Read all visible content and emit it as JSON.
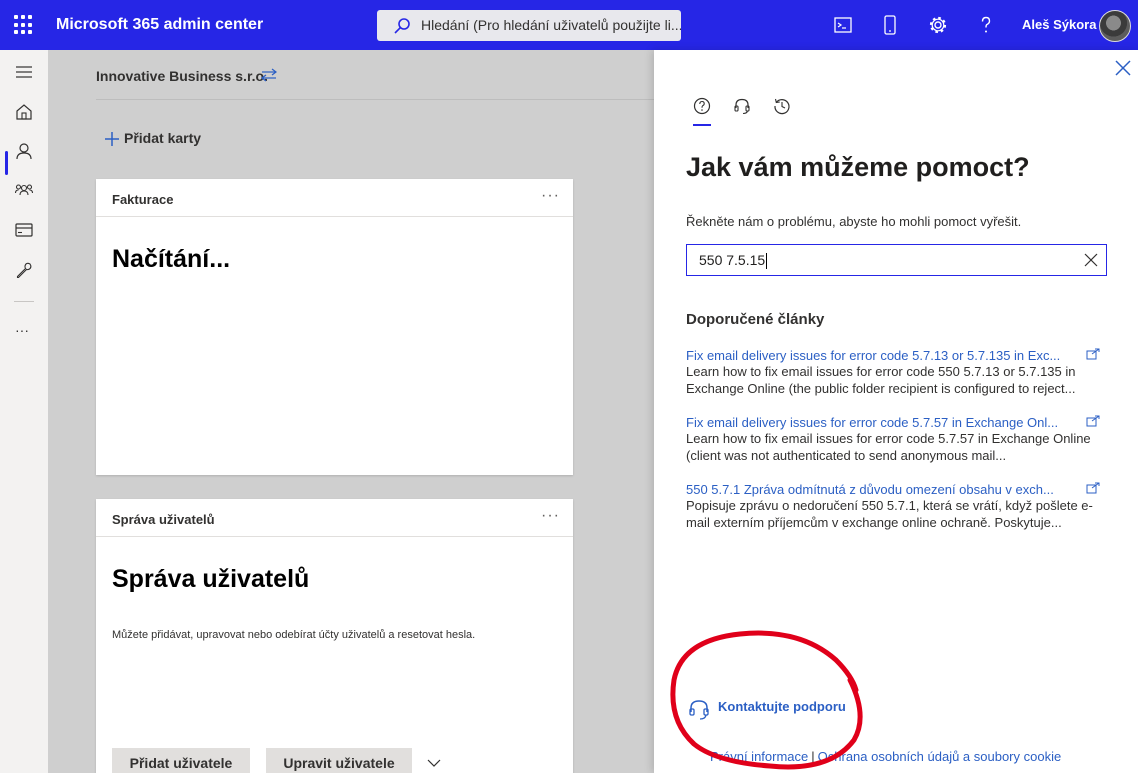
{
  "header": {
    "app_title": "Microsoft 365 admin center",
    "search_placeholder": "Hledání (Pro hledání uživatelů použijte li...",
    "user_name": "Aleš Sýkora",
    "brand_color": "#2626e6",
    "icons": [
      "waffle-icon",
      "terminal-icon",
      "mobile-icon",
      "settings-icon",
      "help-icon"
    ]
  },
  "leftnav": {
    "items": [
      "menu-icon",
      "home-icon",
      "user-icon",
      "group-icon",
      "billing-icon",
      "setup-icon",
      "more-icon"
    ],
    "active": "home-icon",
    "more_label": "···"
  },
  "main": {
    "org_name": "Innovative Business s.r.o.",
    "add_cards": "Přidat karty",
    "cards": [
      {
        "title": "Fakturace",
        "more": "···",
        "big_text": "Načítání..."
      },
      {
        "title": "Správa uživatelů",
        "more": "···",
        "big_text": "Správa uživatelů",
        "description": "Můžete přidávat, upravovat nebo odebírat účty uživatelů a resetovat hesla.",
        "buttons": [
          "Přidat uživatele",
          "Upravit uživatele"
        ]
      }
    ]
  },
  "help_panel": {
    "tabs": [
      "help-icon",
      "headset-icon",
      "history-icon"
    ],
    "active_tab": "help-icon",
    "title": "Jak vám můžeme pomoct?",
    "subtitle": "Řekněte nám o problému, abyste ho mohli pomoct vyřešit.",
    "input_value": "550 7.5.15",
    "recommended_heading": "Doporučené články",
    "articles": [
      {
        "title": "Fix email delivery issues for error code 5.7.13 or 5.7.135 in Exc...",
        "description": "Learn how to fix email issues for error code 550 5.7.13 or 5.7.135 in Exchange Online (the public folder recipient is configured to reject..."
      },
      {
        "title": "Fix email delivery issues for error code 5.7.57 in Exchange Onl...",
        "description": "Learn how to fix email issues for error code 5.7.57 in Exchange Online (client was not authenticated to send anonymous mail..."
      },
      {
        "title": "550 5.7.1 Zpráva odmítnutá z důvodu omezení obsahu v exch...",
        "description": "Popisuje zprávu o nedoručení 550 5.7.1, která se vrátí, když pošlete e-mail externím příjemcům v exchange online ochraně. Poskytuje..."
      }
    ],
    "contact_support": "Kontaktujte podporu",
    "footer_links": [
      "Právní informace",
      "Ochrana osobních údajů a soubory cookie"
    ],
    "footer_separator": "|",
    "annotation_color": "#e0001a"
  }
}
